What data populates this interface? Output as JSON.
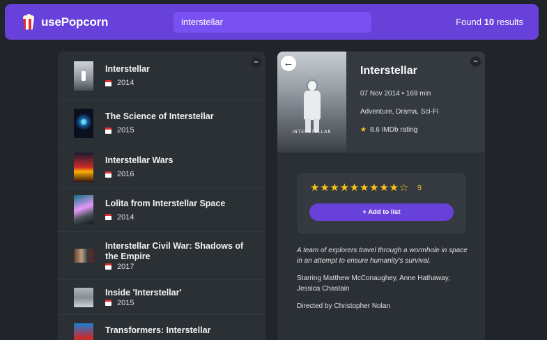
{
  "navbar": {
    "app_name": "usePopcorn",
    "search_value": "interstellar",
    "results_prefix": "Found ",
    "results_count": "10",
    "results_suffix": " results"
  },
  "movie_list": {
    "toggle_label": "–",
    "items": [
      {
        "title": "Interstellar",
        "year": "2014"
      },
      {
        "title": "The Science of Interstellar",
        "year": "2015"
      },
      {
        "title": "Interstellar Wars",
        "year": "2016"
      },
      {
        "title": "Lolita from Interstellar Space",
        "year": "2014"
      },
      {
        "title": "Interstellar Civil War: Shadows of the Empire",
        "year": "2017"
      },
      {
        "title": "Inside 'Interstellar'",
        "year": "2015"
      },
      {
        "title": "Transformers: Interstellar",
        "year": ""
      }
    ]
  },
  "details": {
    "toggle_label": "–",
    "back_label": "←",
    "title": "Interstellar",
    "release_runtime": "07 Nov 2014 • 169 min",
    "genre": "Adventure, Drama, Sci-Fi",
    "imdb_rating": "8.6 IMDb rating",
    "poster_caption": "INTERSTELLAR",
    "user_rating": "9",
    "stars_filled": 9,
    "stars_total": 10,
    "add_button": "+ Add to list",
    "plot": "A team of explorers travel through a wormhole in space in an attempt to ensure humanity's survival.",
    "starring": "Starring Matthew McConaughey, Anne Hathaway, Jessica Chastain",
    "director": "Directed by Christopher Nolan"
  },
  "colors": {
    "accent": "#6741d9",
    "search_bg": "#7950f2",
    "star": "#fcc419",
    "background": "#212529",
    "box": "#2b3035"
  },
  "icons": {
    "logo": "popcorn-icon",
    "year": "calendar-icon",
    "imdb": "star-icon",
    "back": "arrow-left-icon"
  }
}
